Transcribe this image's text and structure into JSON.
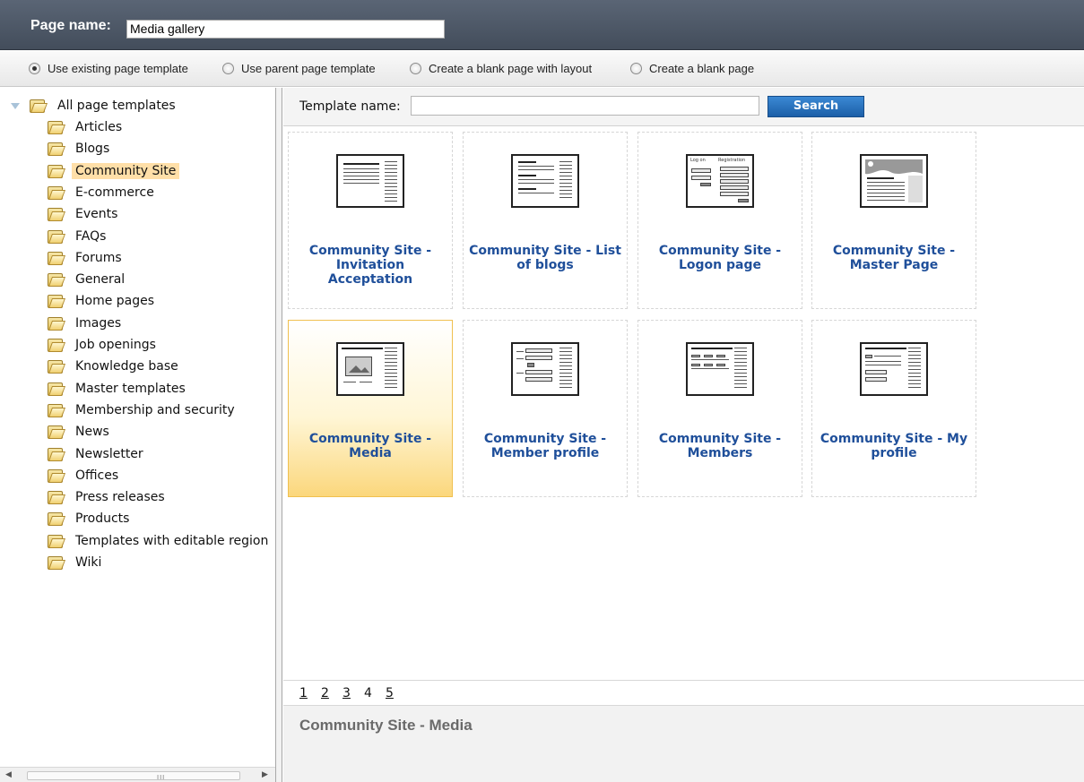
{
  "header": {
    "label": "Page name:",
    "page_name": "Media gallery"
  },
  "options": {
    "selected": "Use existing page template",
    "items": [
      "Use existing page template",
      "Use parent page template",
      "Create a blank page with layout",
      "Create a blank page"
    ]
  },
  "tree": {
    "root": "All page templates",
    "selected": "Community Site",
    "items": [
      "Articles",
      "Blogs",
      "Community Site",
      "E-commerce",
      "Events",
      "FAQs",
      "Forums",
      "General",
      "Home pages",
      "Images",
      "Job openings",
      "Knowledge base",
      "Master templates",
      "Membership and security",
      "News",
      "Newsletter",
      "Offices",
      "Press releases",
      "Products",
      "Templates with editable region",
      "Wiki"
    ]
  },
  "search": {
    "label": "Template name:",
    "value": "",
    "button": "Search"
  },
  "templates": [
    {
      "title": "Community Site - Invitation Acceptation",
      "icon": "text-layout-icon"
    },
    {
      "title": "Community Site - List of blogs",
      "icon": "blog-list-icon"
    },
    {
      "title": "Community Site - Logon page",
      "icon": "logon-form-icon",
      "thumb_text": [
        "Log on",
        "Registration"
      ]
    },
    {
      "title": "Community Site - Master Page",
      "icon": "master-page-icon"
    },
    {
      "title": "Community Site - Media",
      "icon": "media-gallery-icon"
    },
    {
      "title": "Community Site - Member profile",
      "icon": "member-profile-icon"
    },
    {
      "title": "Community Site - Members",
      "icon": "members-list-icon"
    },
    {
      "title": "Community Site - My profile",
      "icon": "my-profile-icon"
    }
  ],
  "selected_template": "Community Site - Media",
  "pager": {
    "pages": [
      "1",
      "2",
      "3",
      "4",
      "5"
    ],
    "current": "4"
  },
  "description": {
    "title": "Community Site - Media"
  },
  "colors": {
    "header_bg": "#4d5766",
    "link_title": "#1f4f9a",
    "selected_bg": "#ffdfa8",
    "search_button": "#2a74c0"
  }
}
